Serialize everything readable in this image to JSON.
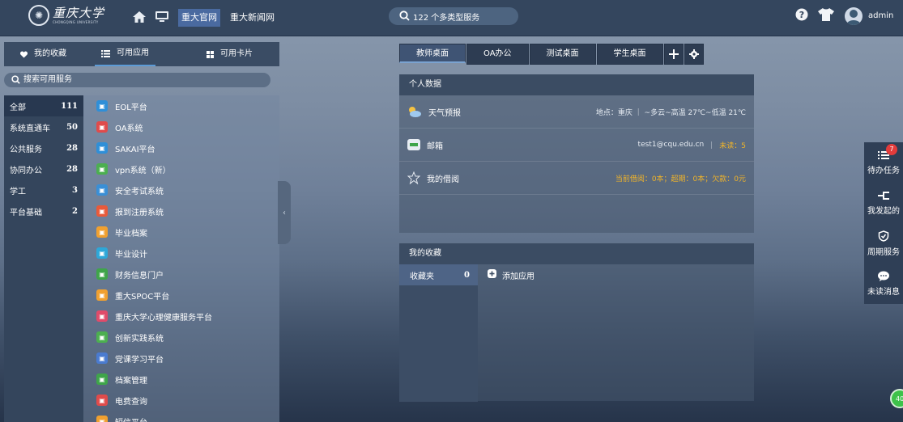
{
  "topbar": {
    "logo_text": "重庆大学",
    "logo_en": "CHONGQING UNIVERSITY",
    "nav_links": [
      "重大官网",
      "重大新闻网"
    ],
    "search_text": "122 个多类型服务",
    "user_name": "admin"
  },
  "left_panel": {
    "tabs": [
      "我的收藏",
      "可用应用",
      "可用卡片"
    ],
    "search_placeholder": "搜索可用服务",
    "categories": [
      {
        "label": "全部",
        "count": "111"
      },
      {
        "label": "系统直通车",
        "count": "50"
      },
      {
        "label": "公共服务",
        "count": "28"
      },
      {
        "label": "协同办公",
        "count": "28"
      },
      {
        "label": "学工",
        "count": "3"
      },
      {
        "label": "平台基础",
        "count": "2"
      }
    ],
    "apps": [
      {
        "label": "EOL平台",
        "color": "#2f8fd8"
      },
      {
        "label": "OA系统",
        "color": "#e04b4b"
      },
      {
        "label": "SAKAI平台",
        "color": "#2f8fd8"
      },
      {
        "label": "vpn系统（新）",
        "color": "#4caf50"
      },
      {
        "label": "安全考试系统",
        "color": "#3a8fd6"
      },
      {
        "label": "报到注册系统",
        "color": "#e85a3a"
      },
      {
        "label": "毕业档案",
        "color": "#f0a030"
      },
      {
        "label": "毕业设计",
        "color": "#2ea7d8"
      },
      {
        "label": "财务信息门户",
        "color": "#3fa54a"
      },
      {
        "label": "重大SPOC平台",
        "color": "#f0a030"
      },
      {
        "label": "重庆大学心理健康服务平台",
        "color": "#e04b6a"
      },
      {
        "label": "创新实践系统",
        "color": "#4caf50"
      },
      {
        "label": "党课学习平台",
        "color": "#4a7bd0"
      },
      {
        "label": "档案管理",
        "color": "#3fa54a"
      },
      {
        "label": "电费查询",
        "color": "#e04b4b"
      },
      {
        "label": "短信平台",
        "color": "#f0a030"
      }
    ]
  },
  "desktop_tabs": [
    "教师桌面",
    "OA办公",
    "测试桌面",
    "学生桌面"
  ],
  "personal_card": {
    "title": "个人数据",
    "weather": {
      "label": "天气预报",
      "value": "地点：重庆 ｜ ~多云~高温 27℃~低温 21℃"
    },
    "mail": {
      "label": "邮箱",
      "address": "test1@cqu.edu.cn",
      "sep": "｜",
      "unread": "未读：5"
    },
    "library": {
      "label": "我的借阅",
      "value": "当前借阅：0本；超期：0本；欠款：0元"
    }
  },
  "favorites_card": {
    "title": "我的收藏",
    "folder": {
      "label": "收藏夹",
      "count": "0"
    },
    "add_label": "添加应用"
  },
  "rail": {
    "items": [
      "待办任务",
      "我发起的",
      "周期服务",
      "未读消息"
    ],
    "todo_badge": "7"
  },
  "corner_badge": "40"
}
